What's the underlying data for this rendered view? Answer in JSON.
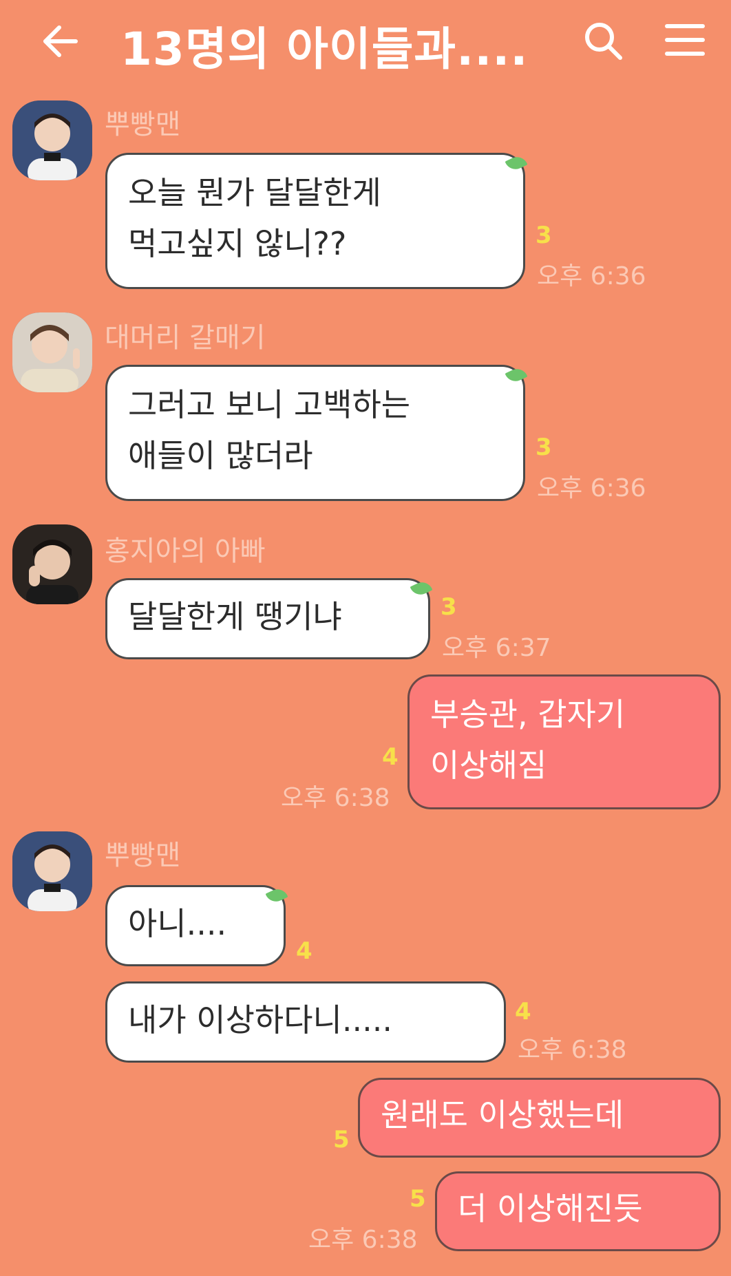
{
  "header": {
    "title": "13명의 아이들과....",
    "back_icon": "arrow-left-icon",
    "search_icon": "search-icon",
    "menu_icon": "hamburger-menu-icon",
    "text_color": "#ffffff"
  },
  "colors": {
    "background": "#F58F6B",
    "bubble_other": "#FFFFFF",
    "bubble_mine": "#FB7A78",
    "unread": "#F7E04A",
    "meta": "#FBC9B5"
  },
  "messages": [
    {
      "sender": "뿌빵맨",
      "lines": [
        "오늘 뭔가 달달한게",
        "먹고싶지 않니??"
      ],
      "unread": "3",
      "time": "오후 6:36"
    },
    {
      "sender": "대머리 갈매기",
      "lines": [
        "그러고 보니 고백하는",
        "애들이 많더라"
      ],
      "unread": "3",
      "time": "오후 6:36"
    },
    {
      "sender": "홍지아의 아빠",
      "lines": [
        "달달한게 땡기냐"
      ],
      "unread": "3",
      "time": "오후 6:37"
    },
    {
      "sender": "",
      "lines": [
        "부승관, 갑자기",
        "이상해짐"
      ],
      "unread": "4",
      "time": "오후 6:38"
    },
    {
      "sender": "뿌빵맨",
      "lines": [
        "아니...."
      ],
      "unread": "4",
      "time": ""
    },
    {
      "sender": "",
      "lines": [
        "내가 이상하다니....."
      ],
      "unread": "4",
      "time": "오후 6:38"
    },
    {
      "sender": "",
      "lines": [
        "원래도 이상했는데"
      ],
      "unread": "5",
      "time": ""
    },
    {
      "sender": "",
      "lines": [
        "더 이상해진듯"
      ],
      "unread": "5",
      "time": "오후 6:38"
    }
  ]
}
